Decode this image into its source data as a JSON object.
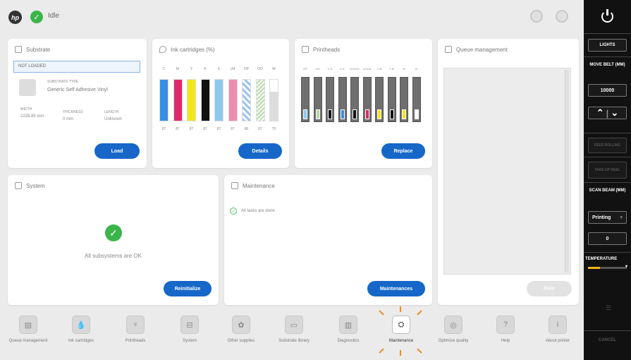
{
  "header": {
    "status": "Idle"
  },
  "substrate": {
    "title": "Substrate",
    "status": "NOT LOADED",
    "type_label": "SUBSTRATE TYPE",
    "type_value": "Generic Self Adhesive Vinyl",
    "width_label": "WIDTH",
    "width_value": "2228.85 mm",
    "thickness_label": "THICKNESS",
    "thickness_value": "0 mm",
    "length_label": "LENGTH",
    "length_value": "Unknown",
    "button": "Load"
  },
  "ink": {
    "title": "Ink cartridges (%)",
    "button": "Details",
    "cartridges": [
      {
        "code": "C",
        "color": "#3a8ee6",
        "level": "87",
        "fill": 1.0,
        "pattern": "solid"
      },
      {
        "code": "M",
        "color": "#e0296b",
        "level": "87",
        "fill": 1.0,
        "pattern": "solid"
      },
      {
        "code": "Y",
        "color": "#f5e61a",
        "level": "87",
        "fill": 1.0,
        "pattern": "solid"
      },
      {
        "code": "K",
        "color": "#111111",
        "level": "87",
        "fill": 1.0,
        "pattern": "solid"
      },
      {
        "code": "lc",
        "color": "#8ec8f0",
        "level": "87",
        "fill": 1.0,
        "pattern": "solid"
      },
      {
        "code": "LM",
        "color": "#f08cb0",
        "level": "87",
        "fill": 1.0,
        "pattern": "solid"
      },
      {
        "code": "OP",
        "color": "#9cc4ee",
        "level": "86",
        "fill": 1.0,
        "pattern": "check"
      },
      {
        "code": "OO",
        "color": "#b5d8a8",
        "level": "87",
        "fill": 1.0,
        "pattern": "stripe"
      },
      {
        "code": "W",
        "color": "#dddddd",
        "level": "70",
        "fill": 0.7,
        "pattern": "solid"
      }
    ]
  },
  "printheads": {
    "title": "Printheads",
    "button": "Replace",
    "heads": [
      {
        "code": "OP",
        "dot": "#8ec8f0"
      },
      {
        "code": "OO",
        "dot": "#b5d8a8"
      },
      {
        "code": "C K",
        "dot": "#111111"
      },
      {
        "code": "C K",
        "dot": "#3a8ee6"
      },
      {
        "code": "OO/OO",
        "dot": "#111111"
      },
      {
        "code": "LC/LM",
        "dot": "#e0296b"
      },
      {
        "code": "Y M",
        "dot": "#f5e61a"
      },
      {
        "code": "Y M",
        "dot": "#111111"
      },
      {
        "code": "W",
        "dot": "#f5e61a"
      },
      {
        "code": "W",
        "dot": "#ffffff"
      }
    ]
  },
  "queue": {
    "title": "Queue management",
    "button": "Print"
  },
  "system": {
    "title": "System",
    "message": "All subsystems are OK",
    "button": "Reinitialize"
  },
  "maintenance": {
    "title": "Maintenance",
    "message": "All tasks are done",
    "button": "Maintenances"
  },
  "bottom_nav": [
    {
      "label": "Queue management",
      "icon": "queue-icon",
      "glyph": "▤"
    },
    {
      "label": "Ink cartridges",
      "icon": "ink-drop-icon",
      "glyph": "💧"
    },
    {
      "label": "Printheads",
      "icon": "printhead-icon",
      "glyph": "♆"
    },
    {
      "label": "System",
      "icon": "system-icon",
      "glyph": "⊟"
    },
    {
      "label": "Other supplies",
      "icon": "supplies-icon",
      "glyph": "✿"
    },
    {
      "label": "Substrate library",
      "icon": "library-icon",
      "glyph": "▭"
    },
    {
      "label": "Diagnostics",
      "icon": "diagnostics-icon",
      "glyph": "▥"
    },
    {
      "label": "Maintenance",
      "icon": "maintenance-icon",
      "glyph": "⛭"
    },
    {
      "label": "Optimize quality",
      "icon": "optimize-icon",
      "glyph": "◎"
    },
    {
      "label": "Help",
      "icon": "help-icon",
      "glyph": "?"
    },
    {
      "label": "About printer",
      "icon": "info-icon",
      "glyph": "i"
    }
  ],
  "side": {
    "lights": "LIGHTS",
    "move_belt": "MOVE BELT (MM)",
    "move_value": "10000",
    "feed_rolling": "FEED ROLLING",
    "take_up": "TAKE UP REEL",
    "scan_beam": "SCAN BEAM (MM)",
    "scan_mode": "Printing",
    "scan_value": "0",
    "temperature": "TEMPERATURE",
    "cancel": "CANCEL"
  }
}
